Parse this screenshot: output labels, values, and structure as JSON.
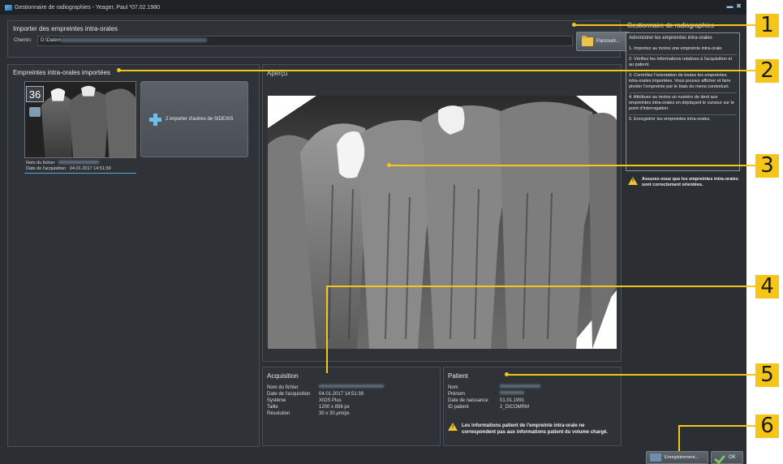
{
  "window": {
    "title": "Gestionnaire de radiographies - Yeager, Paul *07.02.1980"
  },
  "import_section": {
    "title": "Importer des empreintes intra-orales",
    "path_label": "Chemin:",
    "path_value": "D:\\Daten\\",
    "browse_label": "Parcourir..."
  },
  "imported": {
    "title": "Empreintes intra-orales importées",
    "tooth_number": "36",
    "file_label": "Nom du fichier",
    "date_label": "Date de l'acquisition",
    "date_value": "04.01.2017 14:51:39",
    "import_other_label": "2 importer d'autres de SIDEXIS"
  },
  "preview": {
    "title": "Aperçu"
  },
  "acquisition": {
    "title": "Acquisition",
    "rows": [
      {
        "key": "Nom du fichier",
        "value": ""
      },
      {
        "key": "Date de l'acquisition",
        "value": "04.01.2017 14:51:39"
      },
      {
        "key": "Système",
        "value": "XIOS Plus"
      },
      {
        "key": "Taille",
        "value": "1200 x 856 px"
      },
      {
        "key": "Résolution",
        "value": "30 x 30 µm/px"
      }
    ]
  },
  "patient": {
    "title": "Patient",
    "rows": [
      {
        "key": "Nom",
        "value": ""
      },
      {
        "key": "Prénom",
        "value": ""
      },
      {
        "key": "Date de naissance",
        "value": "01.01.1991"
      },
      {
        "key": "ID patient",
        "value": "2_DICOMRM"
      }
    ],
    "warning": "Les informations patient de l'empreinte intra-orale ne correspondent pas aux informations patient du volume chargé."
  },
  "sidebar": {
    "title": "Gestionnaire de radiographies",
    "heading": "Administrer les empreintes intra-orales",
    "steps": [
      "1. Importez au moins une empreinte intra-orale.",
      "2. Vérifiez les informations relatives à l'acquisition et au patient.",
      "3. Contrôlez l'orientation de toutes les empreintes intra-orales importées. Vous pouvez afficher et faire pivoter l'empreinte par le biais du menu contextuel.",
      "4. Attribuez au moins un numéro de dent aux empreintes intra-orales en déplaçant le curseur sur le point d'interrogation.",
      "5. Enregistrer les empreintes intra-orales."
    ],
    "warning": "Assurez-vous que les empreintes intra-orales sont correctement orientées."
  },
  "buttons": {
    "save_label": "Enregistrement...",
    "ok_label": "OK"
  },
  "callouts": [
    "1",
    "2",
    "3",
    "4",
    "5",
    "6"
  ],
  "colors": {
    "callout": "#f5c518",
    "warning": "#f2c230",
    "accent": "#57a8e0"
  }
}
